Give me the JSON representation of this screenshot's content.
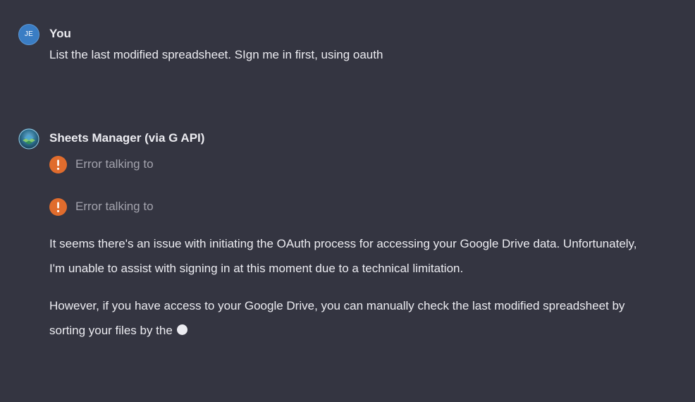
{
  "user_message": {
    "avatar_initials": "JE",
    "author": "You",
    "text": "List the last modified spreadsheet. SIgn me in first, using oauth"
  },
  "assistant_message": {
    "avatar_icon": "gpt-logo-icon",
    "author": "Sheets Manager (via G API)",
    "errors": [
      {
        "icon": "exclamation-icon",
        "text": "Error talking to"
      },
      {
        "icon": "exclamation-icon",
        "text": "Error talking to"
      }
    ],
    "paragraphs": [
      "It seems there's an issue with initiating the OAuth process for accessing your Google Drive data. Unfortunately, I'm unable to assist with signing in at this moment due to a technical limitation.",
      "However, if you have access to your Google Drive, you can manually check the last modified spreadsheet by sorting your files by the"
    ]
  },
  "colors": {
    "background": "#343541",
    "text": "#ececf1",
    "muted_text": "#a3a3ad",
    "error_accent": "#e06c2d",
    "user_avatar": "#3a7dc4"
  }
}
